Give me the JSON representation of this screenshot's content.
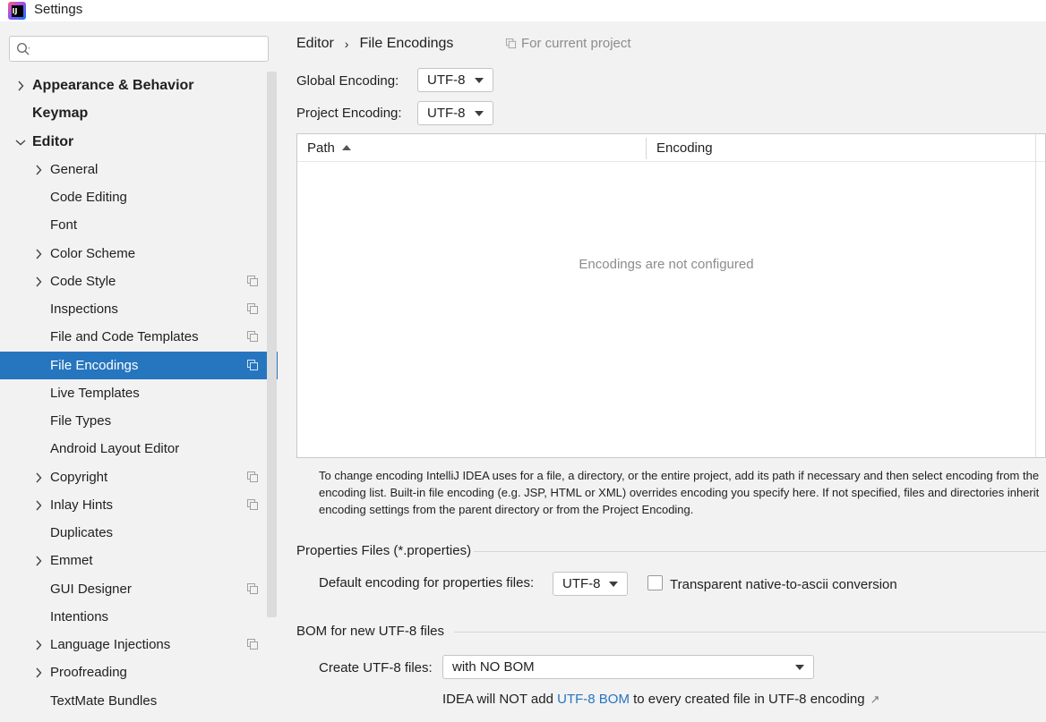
{
  "window": {
    "title": "Settings"
  },
  "search": {
    "value": "",
    "placeholder": ""
  },
  "sidebar": {
    "items": [
      {
        "label": "Appearance & Behavior"
      },
      {
        "label": "Keymap"
      },
      {
        "label": "Editor"
      },
      {
        "label": "General"
      },
      {
        "label": "Code Editing"
      },
      {
        "label": "Font"
      },
      {
        "label": "Color Scheme"
      },
      {
        "label": "Code Style"
      },
      {
        "label": "Inspections"
      },
      {
        "label": "File and Code Templates"
      },
      {
        "label": "File Encodings"
      },
      {
        "label": "Live Templates"
      },
      {
        "label": "File Types"
      },
      {
        "label": "Android Layout Editor"
      },
      {
        "label": "Copyright"
      },
      {
        "label": "Inlay Hints"
      },
      {
        "label": "Duplicates"
      },
      {
        "label": "Emmet"
      },
      {
        "label": "GUI Designer"
      },
      {
        "label": "Intentions"
      },
      {
        "label": "Language Injections"
      },
      {
        "label": "Proofreading"
      },
      {
        "label": "TextMate Bundles"
      }
    ],
    "selected": "File Encodings"
  },
  "breadcrumb": {
    "parent": "Editor",
    "separator": "›",
    "current": "File Encodings"
  },
  "scope_note": "For current project",
  "global_encoding": {
    "label": "Global Encoding:",
    "value": "UTF-8"
  },
  "project_encoding": {
    "label": "Project Encoding:",
    "value": "UTF-8"
  },
  "table": {
    "columns": [
      "Path",
      "Encoding"
    ],
    "empty_text": "Encodings are not configured"
  },
  "help": {
    "text": "To change encoding IntelliJ IDEA uses for a file, a directory, or the entire project, add its path if necessary and then select encoding from the encoding list. Built-in file encoding (e.g. JSP, HTML or XML) overrides encoding you specify here. If not specified, files and directories inherit encoding settings from the parent directory or from the Project Encoding."
  },
  "properties_section": {
    "title": "Properties Files (*.properties)",
    "default_label": "Default encoding for properties files:",
    "default_value": "UTF-8",
    "transparent_label": "Transparent native-to-ascii conversion",
    "transparent_checked": false
  },
  "bom_section": {
    "title": "BOM for new UTF-8 files",
    "create_label": "Create UTF-8 files:",
    "create_value": "with NO BOM",
    "note_prefix": "IDEA will NOT add",
    "note_link": "UTF-8 BOM",
    "note_suffix": "to every created file in UTF-8 encoding",
    "note_arrow": "↗"
  },
  "colors": {
    "selection": "#2675bf",
    "link": "#2675bf",
    "panel": "#f2f2f2"
  }
}
